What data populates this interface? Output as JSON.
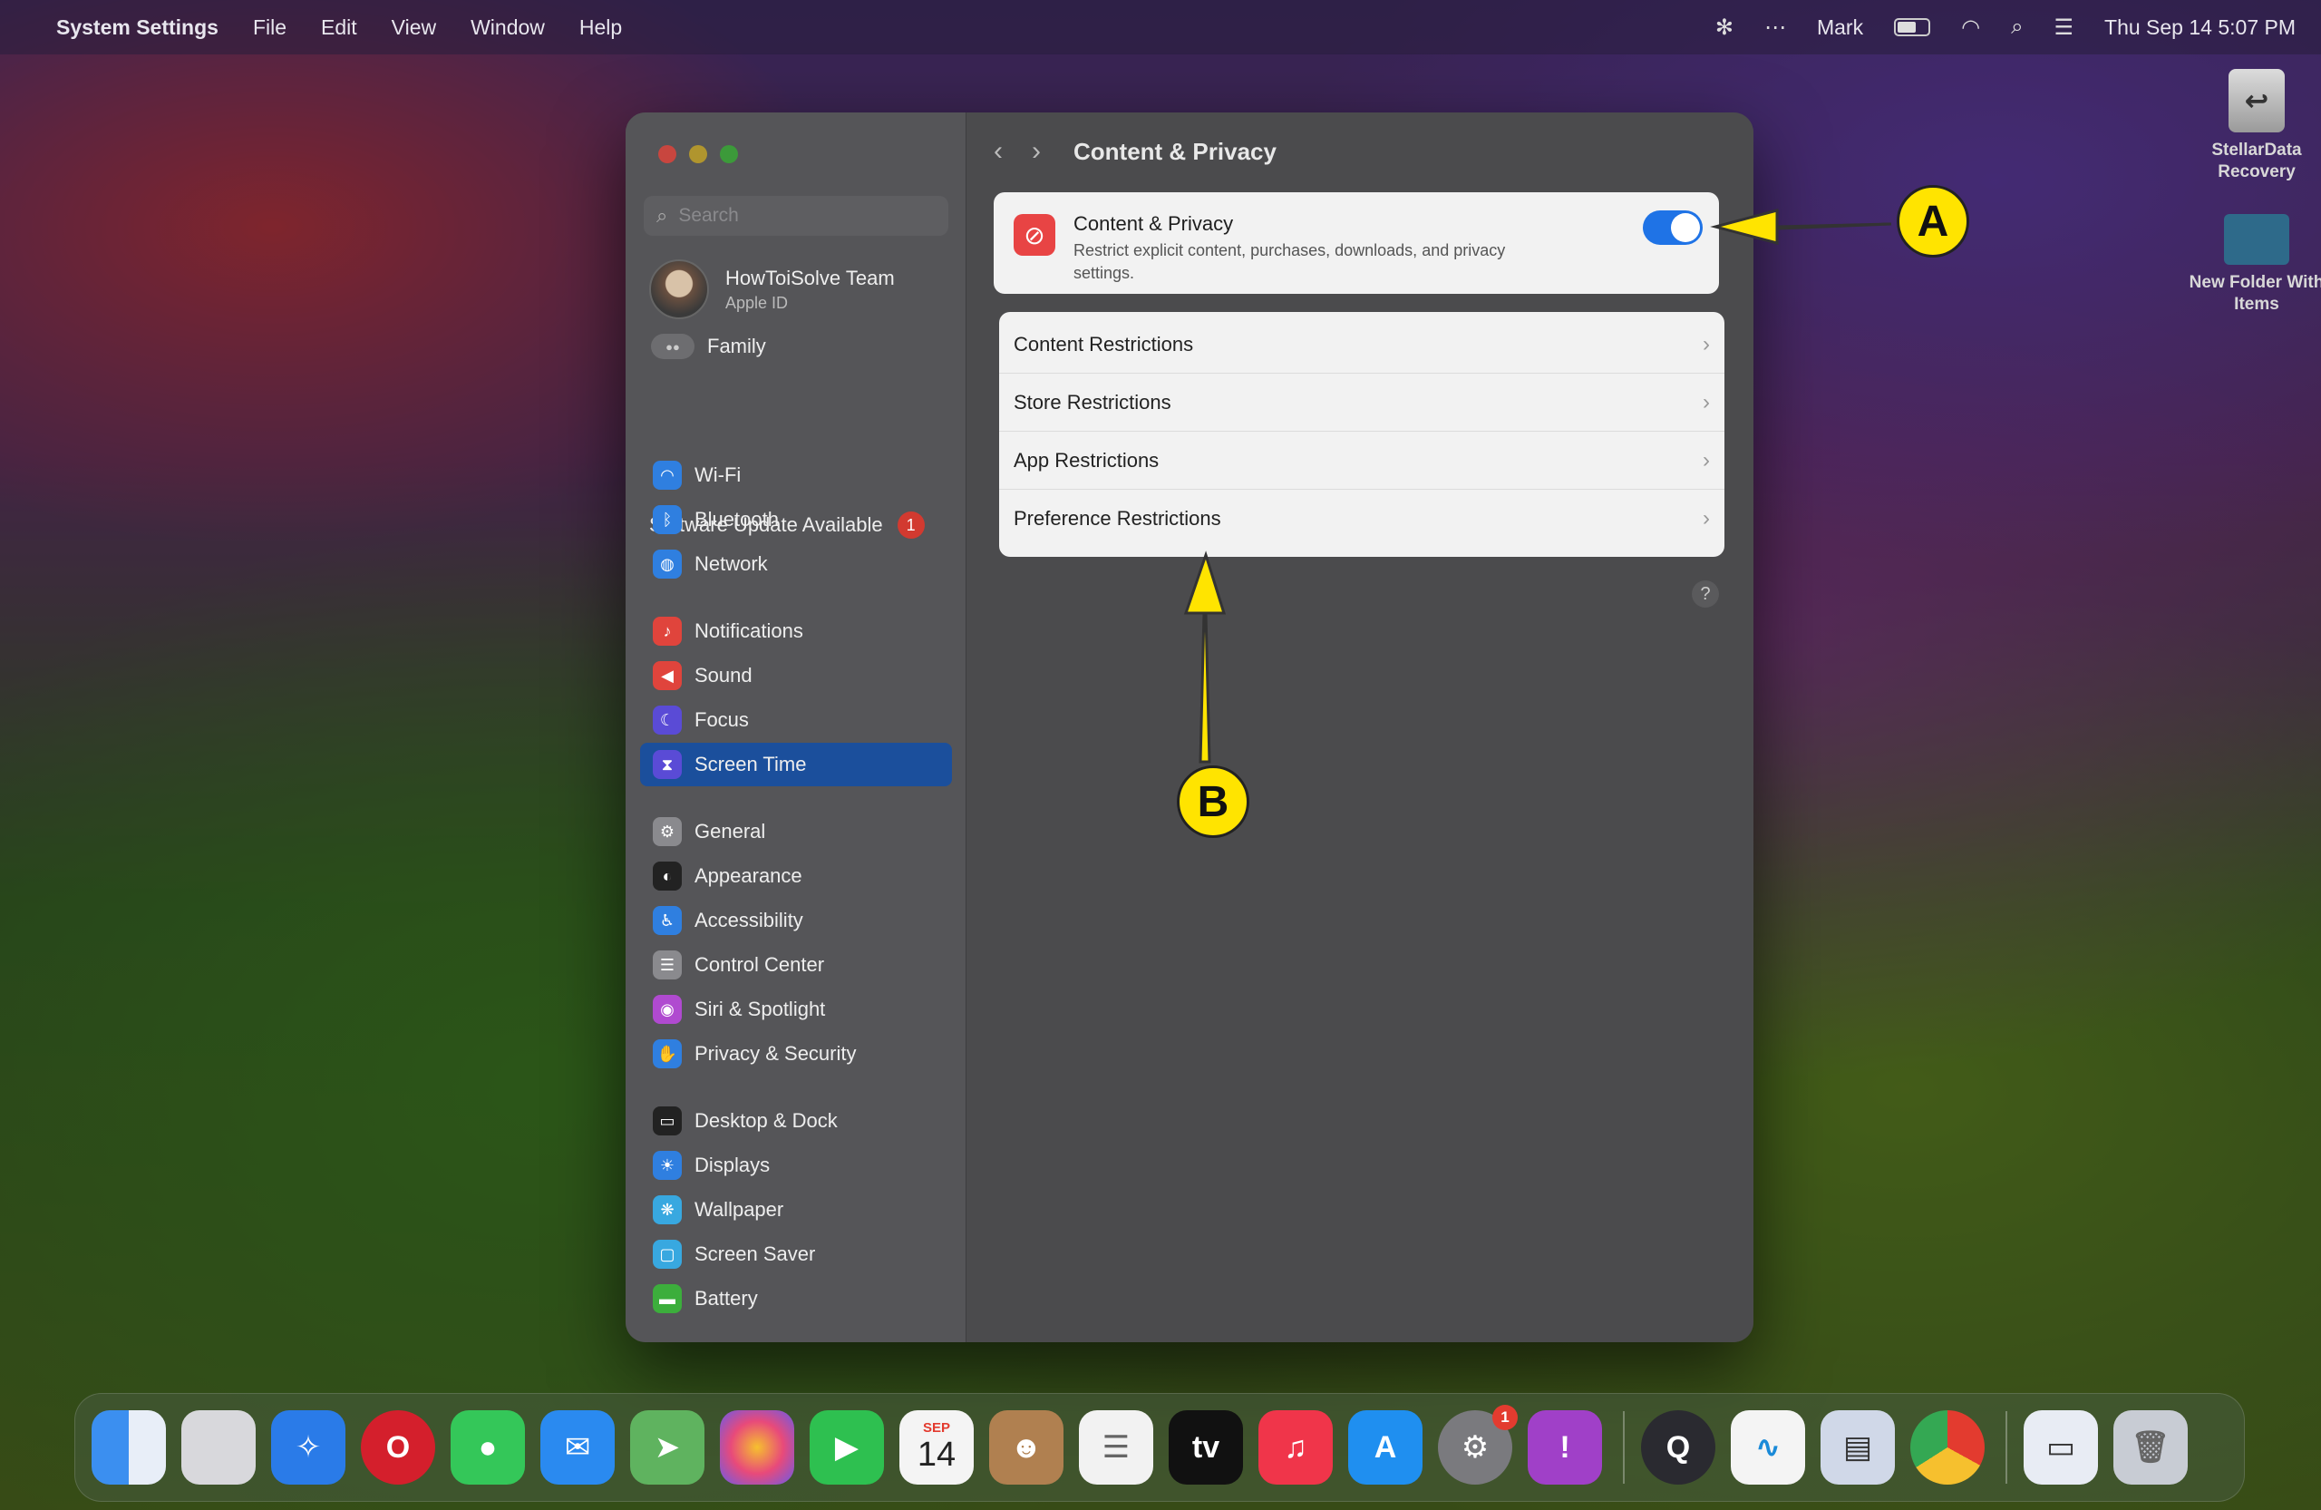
{
  "menubar": {
    "app_name": "System Settings",
    "menus": [
      "File",
      "Edit",
      "View",
      "Window",
      "Help"
    ],
    "user": "Mark",
    "datetime": "Thu Sep 14  5:07 PM"
  },
  "desktop": {
    "drive_label": "StellarData Recovery",
    "folder_label": "New Folder With Items"
  },
  "sidebar": {
    "search_placeholder": "Search",
    "account_name": "HowToiSolve Team",
    "account_sub": "Apple ID",
    "family_label": "Family",
    "update_label": "Software Update Available",
    "update_count": "1",
    "items": [
      {
        "label": "Wi-Fi",
        "icon": "wifi-icon",
        "color": "#2f7fe0"
      },
      {
        "label": "Bluetooth",
        "icon": "bluetooth-icon",
        "color": "#2f7fe0"
      },
      {
        "label": "Network",
        "icon": "globe-icon",
        "color": "#2f7fe0"
      },
      {
        "label": "Notifications",
        "icon": "bell-icon",
        "color": "#e0443c"
      },
      {
        "label": "Sound",
        "icon": "speaker-icon",
        "color": "#e0443c"
      },
      {
        "label": "Focus",
        "icon": "moon-icon",
        "color": "#5a4bd6"
      },
      {
        "label": "Screen Time",
        "icon": "hourglass-icon",
        "color": "#5a4bd6"
      },
      {
        "label": "General",
        "icon": "gear-icon",
        "color": "#8a8a8e"
      },
      {
        "label": "Appearance",
        "icon": "appearance-icon",
        "color": "#222222"
      },
      {
        "label": "Accessibility",
        "icon": "accessibility-icon",
        "color": "#2f7fe0"
      },
      {
        "label": "Control Center",
        "icon": "control-center-icon",
        "color": "#8a8a8e"
      },
      {
        "label": "Siri & Spotlight",
        "icon": "siri-icon",
        "color": "#b04ad0"
      },
      {
        "label": "Privacy & Security",
        "icon": "hand-icon",
        "color": "#2f7fe0"
      },
      {
        "label": "Desktop & Dock",
        "icon": "dock-icon",
        "color": "#222222"
      },
      {
        "label": "Displays",
        "icon": "sun-icon",
        "color": "#2f7fe0"
      },
      {
        "label": "Wallpaper",
        "icon": "wallpaper-icon",
        "color": "#38a8e0"
      },
      {
        "label": "Screen Saver",
        "icon": "screensaver-icon",
        "color": "#38a8e0"
      },
      {
        "label": "Battery",
        "icon": "battery-icon",
        "color": "#3cae3c"
      }
    ]
  },
  "main": {
    "title": "Content & Privacy",
    "toggle_card": {
      "title": "Content & Privacy",
      "description": "Restrict explicit content, purchases, downloads, and privacy settings.",
      "enabled": true
    },
    "rows": [
      "Content Restrictions",
      "Store Restrictions",
      "App Restrictions",
      "Preference Restrictions"
    ],
    "help": "?"
  },
  "annotations": {
    "a": "A",
    "b": "B"
  },
  "dock": {
    "calendar_month": "SEP",
    "calendar_day": "14",
    "settings_badge": "1",
    "apps": [
      "finder-icon",
      "launchpad-icon",
      "safari-icon",
      "opera-icon",
      "messages-icon",
      "mail-icon",
      "maps-icon",
      "photos-icon",
      "facetime-icon",
      "calendar-icon",
      "contacts-icon",
      "reminders-icon",
      "appletv-icon",
      "music-icon",
      "appstore-icon",
      "settings-icon",
      "feedback-icon",
      "quicktime-icon",
      "freeform-icon",
      "preview-icon",
      "chrome-icon",
      "screenshot-icon",
      "trash-icon"
    ]
  }
}
